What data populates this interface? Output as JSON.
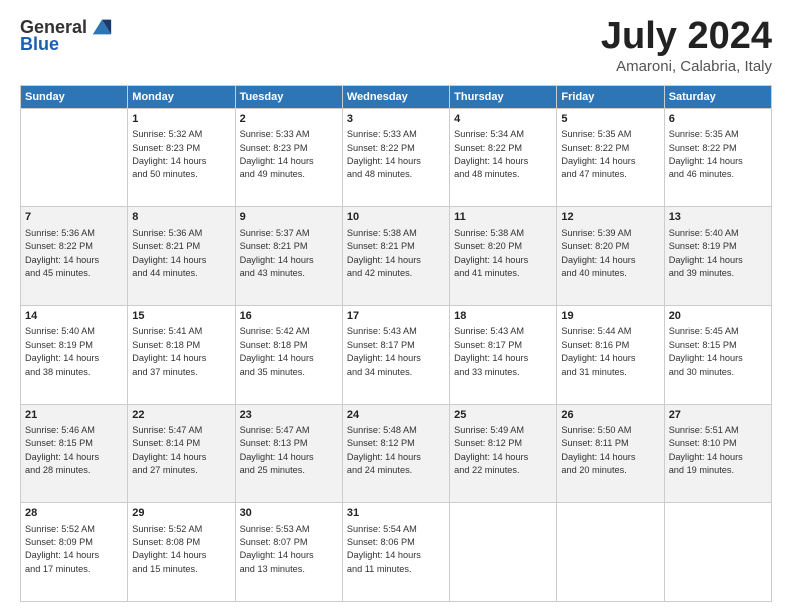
{
  "logo": {
    "general": "General",
    "blue": "Blue"
  },
  "title": "July 2024",
  "subtitle": "Amaroni, Calabria, Italy",
  "header_days": [
    "Sunday",
    "Monday",
    "Tuesday",
    "Wednesday",
    "Thursday",
    "Friday",
    "Saturday"
  ],
  "weeks": [
    {
      "shade": false,
      "days": [
        {
          "num": "",
          "info": ""
        },
        {
          "num": "1",
          "info": "Sunrise: 5:32 AM\nSunset: 8:23 PM\nDaylight: 14 hours\nand 50 minutes."
        },
        {
          "num": "2",
          "info": "Sunrise: 5:33 AM\nSunset: 8:23 PM\nDaylight: 14 hours\nand 49 minutes."
        },
        {
          "num": "3",
          "info": "Sunrise: 5:33 AM\nSunset: 8:22 PM\nDaylight: 14 hours\nand 48 minutes."
        },
        {
          "num": "4",
          "info": "Sunrise: 5:34 AM\nSunset: 8:22 PM\nDaylight: 14 hours\nand 48 minutes."
        },
        {
          "num": "5",
          "info": "Sunrise: 5:35 AM\nSunset: 8:22 PM\nDaylight: 14 hours\nand 47 minutes."
        },
        {
          "num": "6",
          "info": "Sunrise: 5:35 AM\nSunset: 8:22 PM\nDaylight: 14 hours\nand 46 minutes."
        }
      ]
    },
    {
      "shade": true,
      "days": [
        {
          "num": "7",
          "info": "Sunrise: 5:36 AM\nSunset: 8:22 PM\nDaylight: 14 hours\nand 45 minutes."
        },
        {
          "num": "8",
          "info": "Sunrise: 5:36 AM\nSunset: 8:21 PM\nDaylight: 14 hours\nand 44 minutes."
        },
        {
          "num": "9",
          "info": "Sunrise: 5:37 AM\nSunset: 8:21 PM\nDaylight: 14 hours\nand 43 minutes."
        },
        {
          "num": "10",
          "info": "Sunrise: 5:38 AM\nSunset: 8:21 PM\nDaylight: 14 hours\nand 42 minutes."
        },
        {
          "num": "11",
          "info": "Sunrise: 5:38 AM\nSunset: 8:20 PM\nDaylight: 14 hours\nand 41 minutes."
        },
        {
          "num": "12",
          "info": "Sunrise: 5:39 AM\nSunset: 8:20 PM\nDaylight: 14 hours\nand 40 minutes."
        },
        {
          "num": "13",
          "info": "Sunrise: 5:40 AM\nSunset: 8:19 PM\nDaylight: 14 hours\nand 39 minutes."
        }
      ]
    },
    {
      "shade": false,
      "days": [
        {
          "num": "14",
          "info": "Sunrise: 5:40 AM\nSunset: 8:19 PM\nDaylight: 14 hours\nand 38 minutes."
        },
        {
          "num": "15",
          "info": "Sunrise: 5:41 AM\nSunset: 8:18 PM\nDaylight: 14 hours\nand 37 minutes."
        },
        {
          "num": "16",
          "info": "Sunrise: 5:42 AM\nSunset: 8:18 PM\nDaylight: 14 hours\nand 35 minutes."
        },
        {
          "num": "17",
          "info": "Sunrise: 5:43 AM\nSunset: 8:17 PM\nDaylight: 14 hours\nand 34 minutes."
        },
        {
          "num": "18",
          "info": "Sunrise: 5:43 AM\nSunset: 8:17 PM\nDaylight: 14 hours\nand 33 minutes."
        },
        {
          "num": "19",
          "info": "Sunrise: 5:44 AM\nSunset: 8:16 PM\nDaylight: 14 hours\nand 31 minutes."
        },
        {
          "num": "20",
          "info": "Sunrise: 5:45 AM\nSunset: 8:15 PM\nDaylight: 14 hours\nand 30 minutes."
        }
      ]
    },
    {
      "shade": true,
      "days": [
        {
          "num": "21",
          "info": "Sunrise: 5:46 AM\nSunset: 8:15 PM\nDaylight: 14 hours\nand 28 minutes."
        },
        {
          "num": "22",
          "info": "Sunrise: 5:47 AM\nSunset: 8:14 PM\nDaylight: 14 hours\nand 27 minutes."
        },
        {
          "num": "23",
          "info": "Sunrise: 5:47 AM\nSunset: 8:13 PM\nDaylight: 14 hours\nand 25 minutes."
        },
        {
          "num": "24",
          "info": "Sunrise: 5:48 AM\nSunset: 8:12 PM\nDaylight: 14 hours\nand 24 minutes."
        },
        {
          "num": "25",
          "info": "Sunrise: 5:49 AM\nSunset: 8:12 PM\nDaylight: 14 hours\nand 22 minutes."
        },
        {
          "num": "26",
          "info": "Sunrise: 5:50 AM\nSunset: 8:11 PM\nDaylight: 14 hours\nand 20 minutes."
        },
        {
          "num": "27",
          "info": "Sunrise: 5:51 AM\nSunset: 8:10 PM\nDaylight: 14 hours\nand 19 minutes."
        }
      ]
    },
    {
      "shade": false,
      "days": [
        {
          "num": "28",
          "info": "Sunrise: 5:52 AM\nSunset: 8:09 PM\nDaylight: 14 hours\nand 17 minutes."
        },
        {
          "num": "29",
          "info": "Sunrise: 5:52 AM\nSunset: 8:08 PM\nDaylight: 14 hours\nand 15 minutes."
        },
        {
          "num": "30",
          "info": "Sunrise: 5:53 AM\nSunset: 8:07 PM\nDaylight: 14 hours\nand 13 minutes."
        },
        {
          "num": "31",
          "info": "Sunrise: 5:54 AM\nSunset: 8:06 PM\nDaylight: 14 hours\nand 11 minutes."
        },
        {
          "num": "",
          "info": ""
        },
        {
          "num": "",
          "info": ""
        },
        {
          "num": "",
          "info": ""
        }
      ]
    }
  ]
}
